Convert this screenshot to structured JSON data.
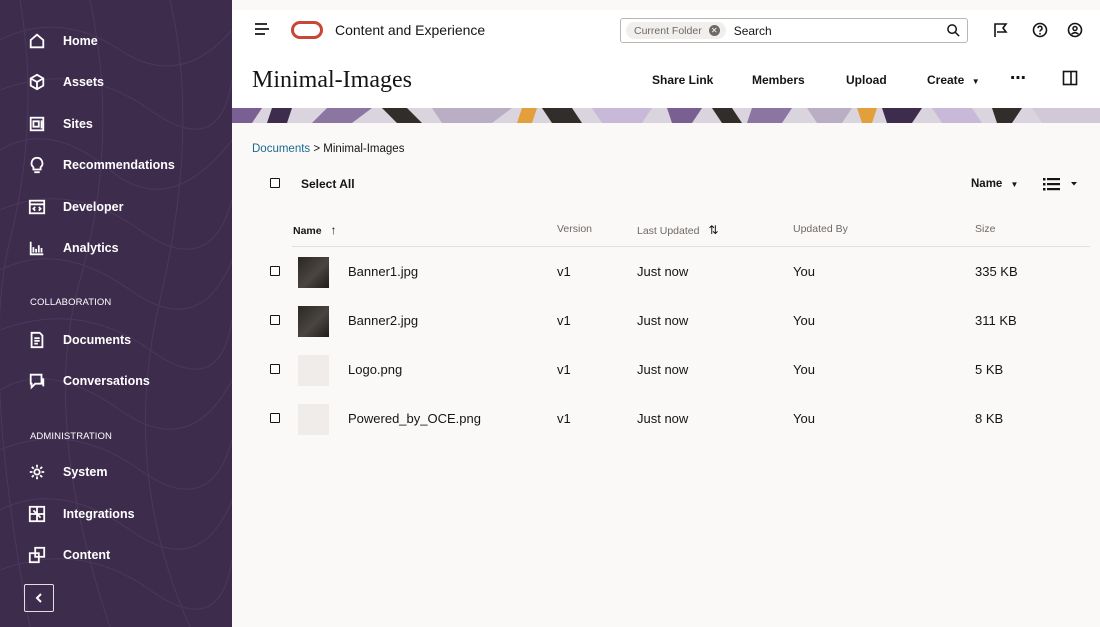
{
  "sidebar": {
    "items": [
      {
        "label": "Home",
        "icon": "home-icon"
      },
      {
        "label": "Assets",
        "icon": "cube-icon"
      },
      {
        "label": "Sites",
        "icon": "sites-icon"
      },
      {
        "label": "Recommendations",
        "icon": "lightbulb-icon"
      },
      {
        "label": "Developer",
        "icon": "code-icon"
      },
      {
        "label": "Analytics",
        "icon": "bar-chart-icon"
      }
    ],
    "collaboration_label": "COLLABORATION",
    "collaboration_items": [
      {
        "label": "Documents",
        "icon": "document-icon"
      },
      {
        "label": "Conversations",
        "icon": "conversation-icon"
      }
    ],
    "administration_label": "ADMINISTRATION",
    "administration_items": [
      {
        "label": "System",
        "icon": "gear-icon"
      },
      {
        "label": "Integrations",
        "icon": "integrations-icon"
      },
      {
        "label": "Content",
        "icon": "content-icon"
      }
    ],
    "background_color": "#3e2c4d"
  },
  "header": {
    "app_title": "Content and Experience",
    "search": {
      "scope_chip": "Current Folder",
      "placeholder": "Search"
    },
    "brand_color": "#c74634"
  },
  "page": {
    "title": "Minimal-Images",
    "actions": {
      "share_link": "Share Link",
      "members": "Members",
      "upload": "Upload",
      "create": "Create"
    }
  },
  "breadcrumb": {
    "root": "Documents",
    "separator": ">",
    "current": "Minimal-Images"
  },
  "toolbar": {
    "select_all": "Select All",
    "sort_label": "Name"
  },
  "table": {
    "columns": {
      "name": "Name",
      "version": "Version",
      "last_updated": "Last Updated",
      "updated_by": "Updated By",
      "size": "Size"
    },
    "rows": [
      {
        "name": "Banner1.jpg",
        "version": "v1",
        "last_updated": "Just now",
        "updated_by": "You",
        "size": "335 KB",
        "thumb": "dark"
      },
      {
        "name": "Banner2.jpg",
        "version": "v1",
        "last_updated": "Just now",
        "updated_by": "You",
        "size": "311 KB",
        "thumb": "dark"
      },
      {
        "name": "Logo.png",
        "version": "v1",
        "last_updated": "Just now",
        "updated_by": "You",
        "size": "5 KB",
        "thumb": "light"
      },
      {
        "name": "Powered_by_OCE.png",
        "version": "v1",
        "last_updated": "Just now",
        "updated_by": "You",
        "size": "8 KB",
        "thumb": "light"
      }
    ]
  }
}
